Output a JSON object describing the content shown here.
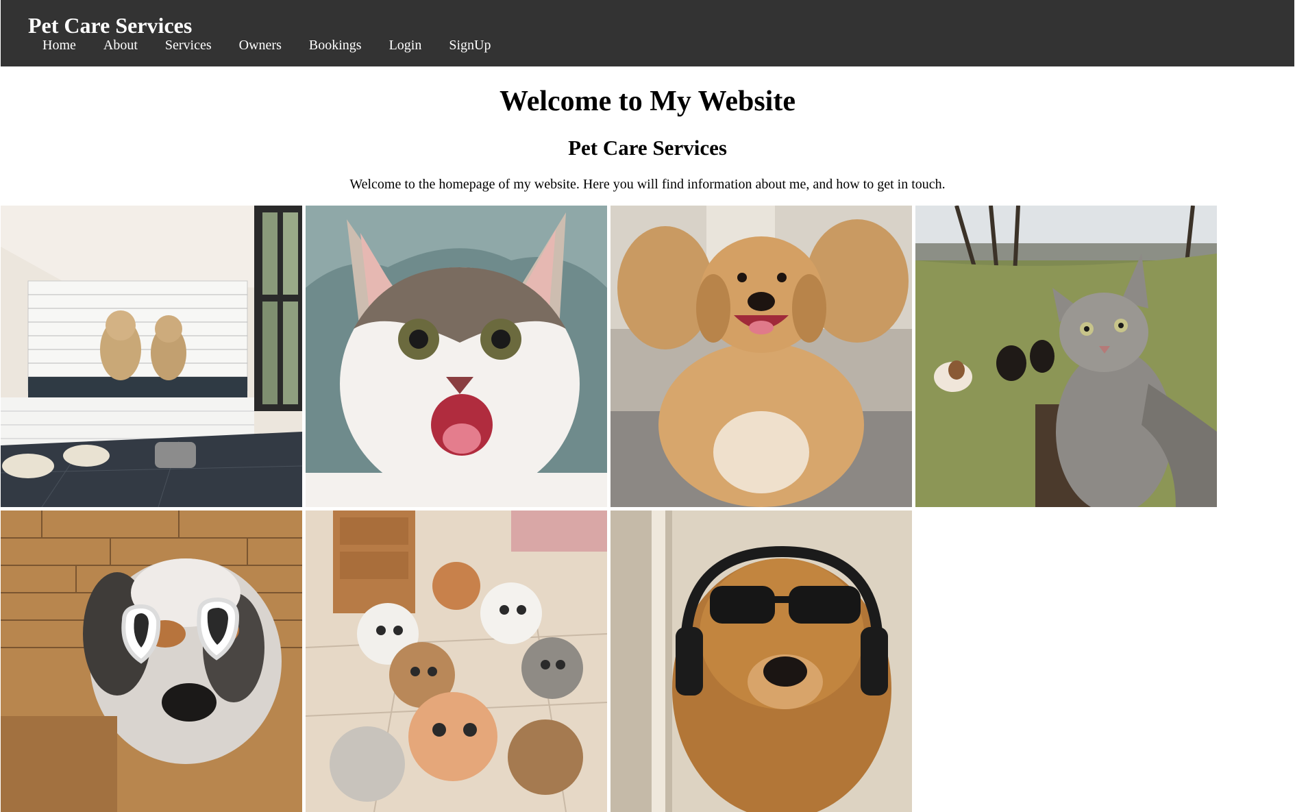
{
  "header": {
    "brand": "Pet Care Services",
    "nav": [
      "Home",
      "About",
      "Services",
      "Owners",
      "Bookings",
      "Login",
      "SignUp"
    ]
  },
  "main": {
    "title": "Welcome to My Website",
    "subtitle": "Pet Care Services",
    "intro": "Welcome to the homepage of my website. Here you will find information about me, and how to get in touch."
  },
  "gallery": [
    {
      "subject": "two-dogs-in-dog-wash-room"
    },
    {
      "subject": "happy-kitten-closeup"
    },
    {
      "subject": "golden-dog-jumping"
    },
    {
      "subject": "cat-selfie-with-dogs-in-field"
    },
    {
      "subject": "dog-with-heart-sunglasses"
    },
    {
      "subject": "group-of-kittens-looking-up"
    },
    {
      "subject": "dog-with-sunglasses-and-headphones"
    }
  ],
  "colors": {
    "header_bg": "#333333",
    "header_text": "#ffffff",
    "page_bg": "#ffffff"
  }
}
